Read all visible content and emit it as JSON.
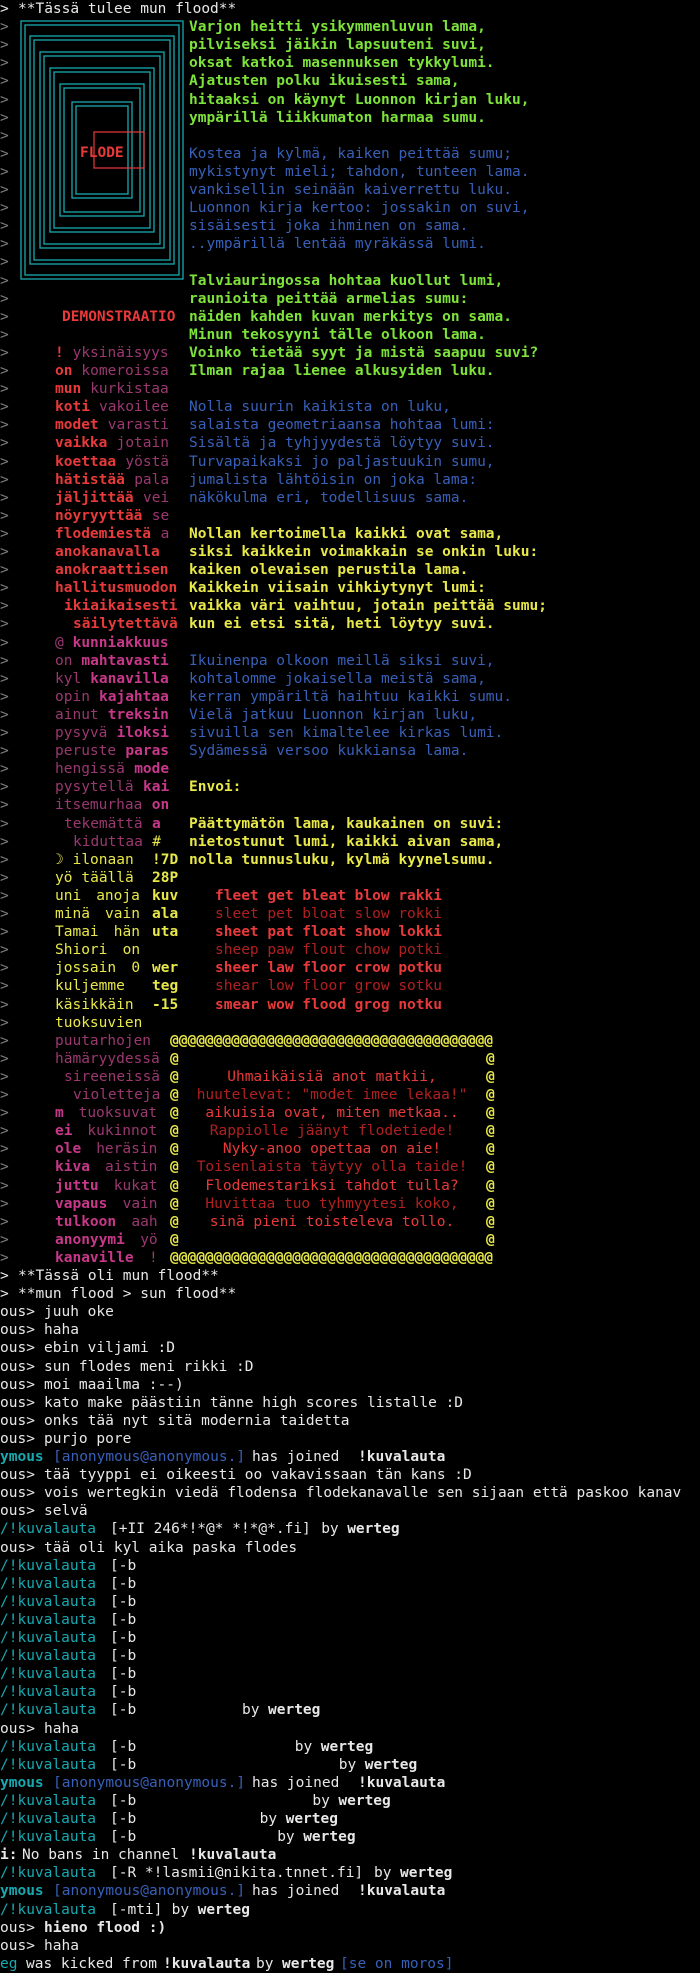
{
  "header": "**Tässä tulee mun flood**",
  "flode_logo": "FLODE",
  "demo_label": "DEMONSTRAATIO",
  "poem": [
    {
      "t": "Varjon heitti ysikymmenluvun lama,",
      "c": "g"
    },
    {
      "t": "pilviseksi jäikin lapsuuteni suvi,",
      "c": "g"
    },
    {
      "t": "oksat katkoi masennuksen tykkylumi.",
      "c": "g"
    },
    {
      "t": "Ajatusten polku ikuisesti sama,",
      "c": "g"
    },
    {
      "t": "hitaaksi on käynyt Luonnon kirjan luku,",
      "c": "g"
    },
    {
      "t": "ympärillä liikkumaton harmaa sumu.",
      "c": "g"
    },
    {
      "t": "",
      "c": "g"
    },
    {
      "t": "Kostea ja kylmä, kaiken peittää sumu;",
      "c": "b"
    },
    {
      "t": "mykistynyt mieli; tahdon, tunteen lama.",
      "c": "b"
    },
    {
      "t": "vankisellin seinään kaiverrettu luku.",
      "c": "b"
    },
    {
      "t": "Luonnon kirja kertoo: jossakin on suvi,",
      "c": "b"
    },
    {
      "t": "sisäisesti joka ihminen on sama.",
      "c": "b"
    },
    {
      "t": "..ympärillä lentää myräkässä lumi.",
      "c": "b"
    },
    {
      "t": "",
      "c": "g"
    },
    {
      "t": "Talviauringossa hohtaa kuollut lumi,",
      "c": "g"
    },
    {
      "t": "raunioita peittää armelias sumu:",
      "c": "g"
    },
    {
      "t": "näiden kahden kuvan merkitys on sama.",
      "c": "g"
    },
    {
      "t": "Minun tekosyyni tälle olkoon lama.",
      "c": "g"
    },
    {
      "t": "Voinko tietää syyt ja mistä saapuu suvi?",
      "c": "g"
    },
    {
      "t": "Ilman rajaa lienee alkusyiden luku.",
      "c": "g"
    },
    {
      "t": "",
      "c": "g"
    },
    {
      "t": "Nolla suurin kaikista on luku,",
      "c": "b"
    },
    {
      "t": "salaista geometriaansa hohtaa lumi:",
      "c": "b"
    },
    {
      "t": "Sisältä ja tyhjyydestä löytyy suvi.",
      "c": "b"
    },
    {
      "t": "Turvapaikaksi jo paljastuukin sumu,",
      "c": "b"
    },
    {
      "t": "jumalista lähtöisin on joka lama:",
      "c": "b"
    },
    {
      "t": "näkökulma eri, todellisuus sama.",
      "c": "b"
    },
    {
      "t": "",
      "c": "g"
    },
    {
      "t": "Nollan kertoimella kaikki ovat sama,",
      "c": "y"
    },
    {
      "t": "siksi kaikkein voimakkain se onkin luku:",
      "c": "y"
    },
    {
      "t": "kaiken olevaisen perustila lama.",
      "c": "y"
    },
    {
      "t": "Kaikkein viisain vihkiytynyt lumi:",
      "c": "y"
    },
    {
      "t": "vaikka väri vaihtuu, jotain peittää sumu;",
      "c": "y"
    },
    {
      "t": "kun ei etsi sitä, heti löytyy suvi.",
      "c": "y"
    },
    {
      "t": "",
      "c": "g"
    },
    {
      "t": "Ikuinenpa olkoon meillä siksi suvi,",
      "c": "b"
    },
    {
      "t": "kohtalomme jokaisella meistä sama,",
      "c": "b"
    },
    {
      "t": "kerran ympäriltä haihtuu kaikki sumu.",
      "c": "b"
    },
    {
      "t": "Vielä jatkuu Luonnon kirjan luku,",
      "c": "b"
    },
    {
      "t": "sivuilla sen kimaltelee kirkas lumi.",
      "c": "b"
    },
    {
      "t": "Sydämessä versoo kukkiansa lama.",
      "c": "b"
    },
    {
      "t": "",
      "c": "g"
    },
    {
      "t": "Envoi:",
      "c": "y"
    },
    {
      "t": "",
      "c": "g"
    },
    {
      "t": "Päättymätön lama, kaukainen on suvi:",
      "c": "y"
    },
    {
      "t": "nietostunut lumi, kaikki aivan sama,",
      "c": "y"
    },
    {
      "t": "nolla tunnusluku, kylmä kyynelsumu.",
      "c": "y"
    }
  ],
  "left_words": [
    {
      "a": "!",
      "ac": "r",
      "b": "yksinäisyys",
      "bc": "md",
      "x": 55
    },
    {
      "a": "on",
      "ac": "r",
      "b": "komeroissa",
      "bc": "md",
      "x": 55
    },
    {
      "a": "mun",
      "ac": "r",
      "b": "kurkistaa",
      "bc": "md",
      "x": 55
    },
    {
      "a": "koti",
      "ac": "r",
      "b": "vakoilee",
      "bc": "md",
      "x": 55
    },
    {
      "a": "modet",
      "ac": "r",
      "b": "varasti",
      "bc": "md",
      "x": 55
    },
    {
      "a": "vaikka",
      "ac": "r",
      "b": "jotain",
      "bc": "md",
      "x": 55
    },
    {
      "a": "koettaa",
      "ac": "r",
      "b": "yöstä",
      "bc": "md",
      "x": 55
    },
    {
      "a": "hätistää",
      "ac": "r",
      "b": "pala",
      "bc": "md",
      "x": 55
    },
    {
      "a": "jäljittää",
      "ac": "r",
      "b": "vei",
      "bc": "md",
      "x": 55
    },
    {
      "a": "nöyryyttää",
      "ac": "r",
      "b": "se",
      "bc": "md",
      "x": 55
    },
    {
      "a": "flodemiestä",
      "ac": "r",
      "b": "a",
      "bc": "md",
      "x": 55
    },
    {
      "a": "anokanavalla",
      "ac": "r",
      "b": "",
      "bc": "md",
      "x": 55
    },
    {
      "a": "anokraattisen",
      "ac": "r",
      "b": "",
      "bc": "md",
      "x": 55
    },
    {
      "a": "hallitusmuodon",
      "ac": "r",
      "b": "",
      "bc": "md",
      "x": 55
    },
    {
      "a": "ikiaikaisesti",
      "ac": "r",
      "b": "",
      "bc": "md",
      "x": 64
    },
    {
      "a": "säilytettävä",
      "ac": "r",
      "b": "",
      "bc": "md",
      "x": 73
    },
    {
      "a": "@",
      "ac": "md",
      "b": "kunniakkuus",
      "bc": "m",
      "x": 55
    },
    {
      "a": "on",
      "ac": "md",
      "b": "mahtavasti",
      "bc": "m",
      "x": 55
    },
    {
      "a": "kyl",
      "ac": "md",
      "b": "kanavilla",
      "bc": "m",
      "x": 55
    },
    {
      "a": "opin",
      "ac": "md",
      "b": "kajahtaa",
      "bc": "m",
      "x": 55
    },
    {
      "a": "ainut",
      "ac": "md",
      "b": "treksin",
      "bc": "m",
      "x": 55
    },
    {
      "a": "pysyvä",
      "ac": "md",
      "b": "iloksi",
      "bc": "m",
      "x": 55
    },
    {
      "a": "peruste",
      "ac": "md",
      "b": "paras",
      "bc": "m",
      "x": 55
    },
    {
      "a": "hengissä",
      "ac": "md",
      "b": "mode",
      "bc": "m",
      "x": 55
    },
    {
      "a": "pysytellä",
      "ac": "md",
      "b": "kai",
      "bc": "m",
      "x": 55
    },
    {
      "a": "itsemurhaa",
      "ac": "md",
      "b": "on",
      "bc": "m",
      "x": 55
    },
    {
      "a": "tekemättä",
      "ac": "md",
      "b": "a",
      "bc": "m",
      "x": 64
    },
    {
      "a": "kiduttaa",
      "ac": "md",
      "b": "#",
      "bc": "y",
      "x": 73
    },
    {
      "a": "☽",
      "ac": "y",
      "b": "ilonaan",
      "bc": "y",
      "x": 55
    },
    {
      "a": "yö",
      "ac": "y",
      "b": "täällä",
      "bc": "y",
      "x": 55
    }
  ],
  "score_words": [
    {
      "a": "uni",
      "b": "anoja",
      "v": "kuv"
    },
    {
      "a": "minä",
      "b": "vain",
      "v": "ala"
    },
    {
      "a": "Tamai",
      "b": "hän",
      "v": "uta"
    },
    {
      "a": "Shiori",
      "b": "on",
      "v": ""
    },
    {
      "a": "jossain",
      "b": "0",
      "v": "wer"
    },
    {
      "a": "kuljemme",
      "b": "",
      "v": "teg"
    },
    {
      "a": "käsikkäin",
      "b": "",
      "v": "-15"
    },
    {
      "a": "tuoksuvien",
      "b": "",
      "v": ""
    }
  ],
  "code_vals": [
    "!7D",
    "28P"
  ],
  "word_grid": [
    {
      "t": "fleet get bleat blow rakki",
      "c": "r"
    },
    {
      "t": "sleet pet bloat slow rokki",
      "c": "rd"
    },
    {
      "t": "sheet pat float show lokki",
      "c": "r"
    },
    {
      "t": "sheep paw flout chow potki",
      "c": "rd"
    },
    {
      "t": "sheer law floor crow potku",
      "c": "r"
    },
    {
      "t": "shear low floor grow sotku",
      "c": "rd"
    },
    {
      "t": "smear wow flood grog notku",
      "c": "r"
    }
  ],
  "at_box": {
    "border_top": "@@@@@@@@@@@@@@@@@@@@@@@@@@@@@@@@@@@@@",
    "lines": [
      {
        "t": "",
        "c": "r"
      },
      {
        "t": "Uhmaikäisiä anot matkii,",
        "c": "r"
      },
      {
        "t": "huutelevat: \"modet imee lekaa!\"",
        "c": "rd"
      },
      {
        "t": "aikuisia ovat, miten metkaa..",
        "c": "r"
      },
      {
        "t": "Rappiolle jäänyt flodetiede!",
        "c": "rd"
      },
      {
        "t": "Nyky-anoo opettaa on aie!",
        "c": "r"
      },
      {
        "t": "Toisenlaista täytyy olla taide!",
        "c": "rd"
      },
      {
        "t": "Flodemestariksi tahdot tulla?",
        "c": "r"
      },
      {
        "t": "Huvittaa tuo tyhmyytesi koko,",
        "c": "rd"
      },
      {
        "t": "sinä pieni toisteleva tollo.",
        "c": "r"
      },
      {
        "t": "",
        "c": "r"
      }
    ]
  },
  "box_left": [
    {
      "a": "puutarhojen",
      "ac": "md",
      "b": "",
      "bc": "md",
      "x": 55
    },
    {
      "a": "hämäryydessä",
      "ac": "md",
      "b": "",
      "bc": "md",
      "x": 55
    },
    {
      "a": "sireeneissä",
      "ac": "md",
      "b": "",
      "bc": "md",
      "x": 64
    },
    {
      "a": "violetteja",
      "ac": "md",
      "b": "",
      "bc": "md",
      "x": 73
    },
    {
      "a": "m",
      "ac": "m",
      "b": "tuoksuvat",
      "bc": "md",
      "x": 55
    },
    {
      "a": "ei",
      "ac": "m",
      "b": "kukinnot",
      "bc": "md",
      "x": 55
    },
    {
      "a": "ole",
      "ac": "m",
      "b": "heräsin",
      "bc": "md",
      "x": 55
    },
    {
      "a": "kiva",
      "ac": "m",
      "b": "aistin",
      "bc": "md",
      "x": 55
    },
    {
      "a": "juttu",
      "ac": "m",
      "b": "kukat",
      "bc": "md",
      "x": 55
    },
    {
      "a": "vapaus",
      "ac": "m",
      "b": "vain",
      "bc": "md",
      "x": 55
    },
    {
      "a": "tulkoon",
      "ac": "m",
      "b": "aah",
      "bc": "md",
      "x": 55
    },
    {
      "a": "anonyymi",
      "ac": "m",
      "b": "yö",
      "bc": "md",
      "x": 55
    },
    {
      "a": "kanaville",
      "ac": "m",
      "b": "!",
      "bc": "md",
      "x": 55
    }
  ],
  "footer_lines": [
    "**Tässä oli mun flood**",
    "**mun flood > sun flood**"
  ],
  "irc": [
    {
      "type": "msg",
      "nick": "ous>",
      "text": "juuh oke"
    },
    {
      "type": "msg",
      "nick": "ous>",
      "text": "haha"
    },
    {
      "type": "msg",
      "nick": "ous>",
      "text": "ebin viljami :D"
    },
    {
      "type": "msg",
      "nick": "ous>",
      "text": "sun flodes meni rikki :D"
    },
    {
      "type": "msg",
      "nick": "ous>",
      "text": "moi maailma :--)"
    },
    {
      "type": "msg",
      "nick": "ous>",
      "text": "kato make päästiin tänne high scores listalle :D"
    },
    {
      "type": "msg",
      "nick": "ous>",
      "text": "onks tää nyt sitä modernia taidetta"
    },
    {
      "type": "msg",
      "nick": "ous>",
      "text": "purjo pore"
    },
    {
      "type": "join",
      "who": "ymous",
      "host": "[anonymous@anonymous.]",
      "text": "has joined",
      "chan": "!kuvalauta"
    },
    {
      "type": "msg",
      "nick": "ous>",
      "text": "tää tyyppi ei oikeesti oo vakavissaan tän kans :D"
    },
    {
      "type": "msg",
      "nick": "ous>",
      "text": "vois wertegkin viedä flodensa flodekanavalle sen sijaan että paskoo kanav"
    },
    {
      "type": "msg",
      "nick": "ous>",
      "text": "selvä"
    },
    {
      "type": "mode",
      "chan": "/!kuvalauta",
      "mode": "[+II 246*!*@* *!*@*.fi]",
      "by": "werteg",
      "pad": 1
    },
    {
      "type": "msg",
      "nick": "ous>",
      "text": "tää oli kyl aika paska flodes"
    },
    {
      "type": "mode",
      "chan": "/!kuvalauta",
      "mode": "[-b",
      "by": "",
      "pad": 0
    },
    {
      "type": "mode",
      "chan": "/!kuvalauta",
      "mode": "[-b",
      "by": "",
      "pad": 0
    },
    {
      "type": "mode",
      "chan": "/!kuvalauta",
      "mode": "[-b",
      "by": "",
      "pad": 0
    },
    {
      "type": "mode",
      "chan": "/!kuvalauta",
      "mode": "[-b",
      "by": "",
      "pad": 0
    },
    {
      "type": "mode",
      "chan": "/!kuvalauta",
      "mode": "[-b",
      "by": "",
      "pad": 0
    },
    {
      "type": "mode",
      "chan": "/!kuvalauta",
      "mode": "[-b",
      "by": "",
      "pad": 0
    },
    {
      "type": "mode",
      "chan": "/!kuvalauta",
      "mode": "[-b",
      "by": "",
      "pad": 0
    },
    {
      "type": "mode",
      "chan": "/!kuvalauta",
      "mode": "[-b",
      "by": "",
      "pad": 0
    },
    {
      "type": "mode",
      "chan": "/!kuvalauta",
      "mode": "[-b",
      "by": "werteg",
      "pad": 12
    },
    {
      "type": "msg",
      "nick": "ous>",
      "text": "haha"
    },
    {
      "type": "mode",
      "chan": "/!kuvalauta",
      "mode": "[-b",
      "by": "werteg",
      "pad": 18
    },
    {
      "type": "mode",
      "chan": "/!kuvalauta",
      "mode": "[-b",
      "by": "werteg",
      "pad": 23
    },
    {
      "type": "join",
      "who": "ymous",
      "host": "[anonymous@anonymous.]",
      "text": "has joined",
      "chan": "!kuvalauta"
    },
    {
      "type": "mode",
      "chan": "/!kuvalauta",
      "mode": "[-b",
      "by": "werteg",
      "pad": 20
    },
    {
      "type": "mode",
      "chan": "/!kuvalauta",
      "mode": "[-b",
      "by": "werteg",
      "pad": 14
    },
    {
      "type": "mode",
      "chan": "/!kuvalauta",
      "mode": "[-b",
      "by": "werteg",
      "pad": 16
    },
    {
      "type": "info",
      "pre": "i:",
      "text": "No bans in channel",
      "chan": "!kuvalauta"
    },
    {
      "type": "mode",
      "chan": "/!kuvalauta",
      "mode": "[-R *!lasmii@nikita.tnnet.fi]",
      "by": "werteg",
      "pad": 1
    },
    {
      "type": "join",
      "who": "ymous",
      "host": "[anonymous@anonymous.]",
      "text": "has joined",
      "chan": "!kuvalauta"
    },
    {
      "type": "mode",
      "chan": "/!kuvalauta",
      "mode": "[-mti]",
      "by": "werteg",
      "pad": 1
    },
    {
      "type": "msgb",
      "nick": "ous>",
      "text": "hieno flood :)"
    },
    {
      "type": "msg",
      "nick": "ous>",
      "text": "haha"
    },
    {
      "type": "kick",
      "who": "eg",
      "text": "was kicked from",
      "chan": "!kuvalauta",
      "by_word": "by",
      "by": "werteg",
      "reason": "[se on moros]"
    }
  ],
  "irc_words": {
    "by": "by"
  }
}
